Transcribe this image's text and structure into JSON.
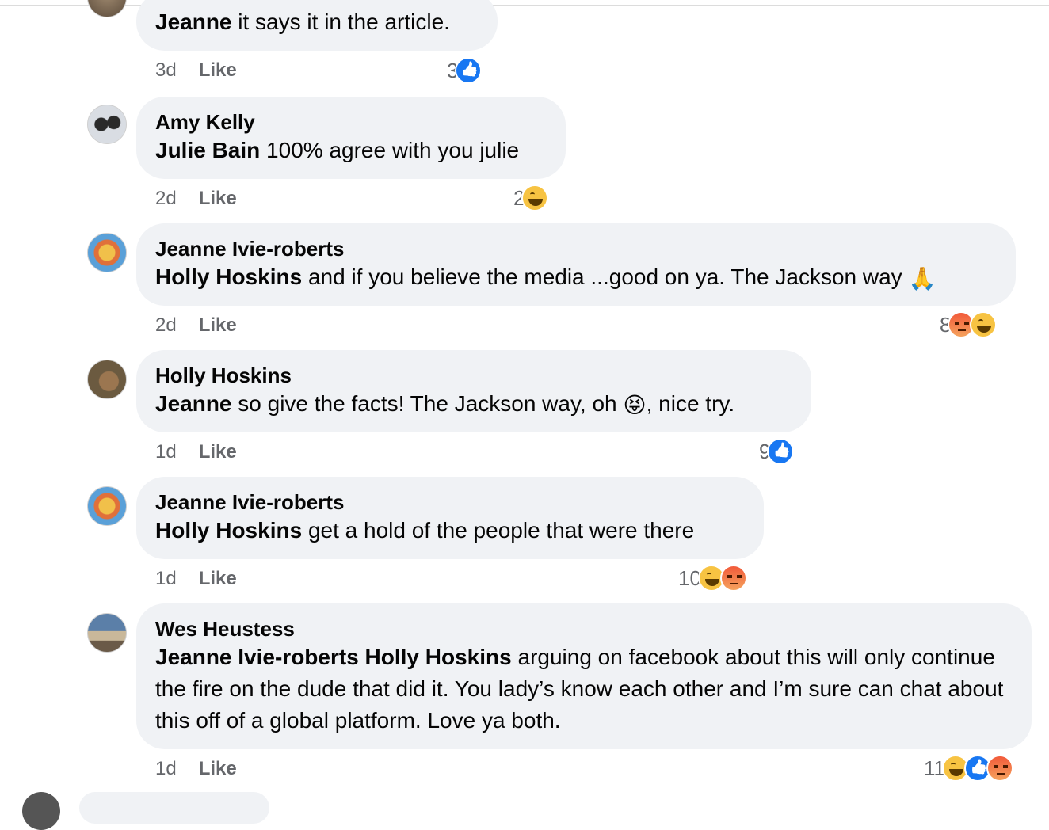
{
  "comments": [
    {
      "author": "",
      "mention": "Jeanne",
      "text": " it says it in the article.",
      "time": "3d",
      "like_label": "Like",
      "reaction_count": "3",
      "reactions": [
        "like"
      ]
    },
    {
      "author": "Amy Kelly",
      "mention": "Julie Bain",
      "text": " 100% agree with you julie",
      "time": "2d",
      "like_label": "Like",
      "reaction_count": "2",
      "reactions": [
        "haha"
      ]
    },
    {
      "author": "Jeanne Ivie-roberts",
      "mention": "Holly Hoskins",
      "text": " and if you believe the media ...good on ya. The Jackson way ",
      "emoji": "🙏",
      "time": "2d",
      "like_label": "Like",
      "reaction_count": "8",
      "reactions": [
        "angry",
        "haha"
      ]
    },
    {
      "author": "Holly Hoskins",
      "mention": "Jeanne",
      "text": " so give the facts! The Jackson way, oh ",
      "emoji": "😝",
      "text_after": ", nice try.",
      "time": "1d",
      "like_label": "Like",
      "reaction_count": "9",
      "reactions": [
        "like"
      ]
    },
    {
      "author": "Jeanne Ivie-roberts",
      "mention": "Holly Hoskins",
      "text": " get a hold of the people that were there",
      "time": "1d",
      "like_label": "Like",
      "reaction_count": "10",
      "reactions": [
        "haha",
        "angry"
      ]
    },
    {
      "author": "Wes Heustess",
      "mention": "Jeanne Ivie-roberts Holly Hoskins",
      "text": " arguing on facebook about this will only continue the fire on the dude that did it. You lady’s know each other and I’m sure can chat about this off of a global platform. Love ya both.",
      "time": "1d",
      "like_label": "Like",
      "reaction_count": "11",
      "reactions": [
        "haha",
        "like",
        "angry"
      ]
    }
  ],
  "colors": {
    "bubble_bg": "#f0f2f5",
    "meta_text": "#65676b",
    "like_blue": "#1877f2",
    "haha_yellow": "#f7c342",
    "angry_red": "#f25a3a"
  }
}
